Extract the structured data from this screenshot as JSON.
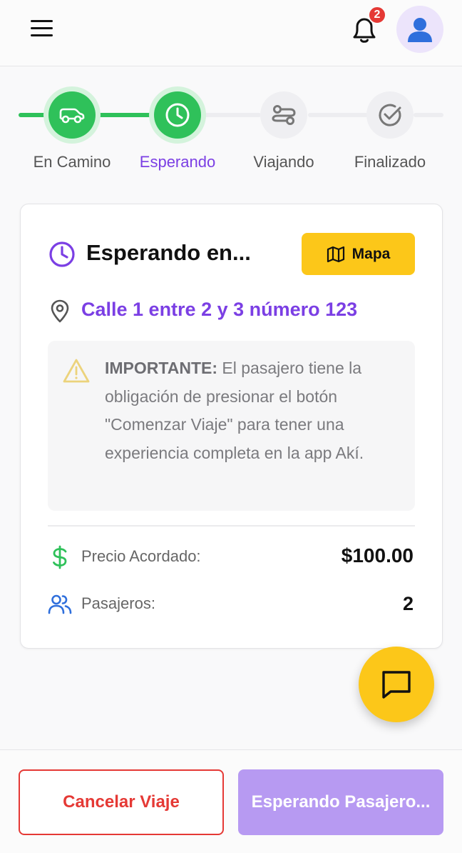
{
  "header": {
    "notification_count": "2",
    "icons": {
      "menu": "hamburger-icon",
      "bell": "bell-icon",
      "avatar": "user-silhouette-icon"
    }
  },
  "stepper": {
    "steps": [
      {
        "label": "En Camino",
        "state": "done",
        "icon": "car-icon"
      },
      {
        "label": "Esperando",
        "state": "current",
        "icon": "clock-icon"
      },
      {
        "label": "Viajando",
        "state": "pending",
        "icon": "route-icon"
      },
      {
        "label": "Finalizado",
        "state": "pending",
        "icon": "check-circle-icon"
      }
    ]
  },
  "card": {
    "title": "Esperando en...",
    "map_button": "Mapa",
    "address": "Calle 1 entre 2 y 3 número 123",
    "notice": {
      "bold": "IMPORTANTE:",
      "text": " El pasajero tiene la obligación de presionar el botón \"Comenzar Viaje\" para tener una experiencia completa en la app Akí."
    },
    "price_label": "Precio Acordado:",
    "price_value": "$100.00",
    "passengers_label": "Pasajeros:",
    "passengers_value": "2"
  },
  "footer": {
    "cancel_label": "Cancelar Viaje",
    "waiting_label": "Esperando Pasajero..."
  },
  "colors": {
    "accent_purple": "#7b3fe4",
    "success_green": "#2fc15a",
    "brand_yellow": "#fcc719",
    "danger_red": "#e53935",
    "disabled_purple": "#b79af2"
  }
}
